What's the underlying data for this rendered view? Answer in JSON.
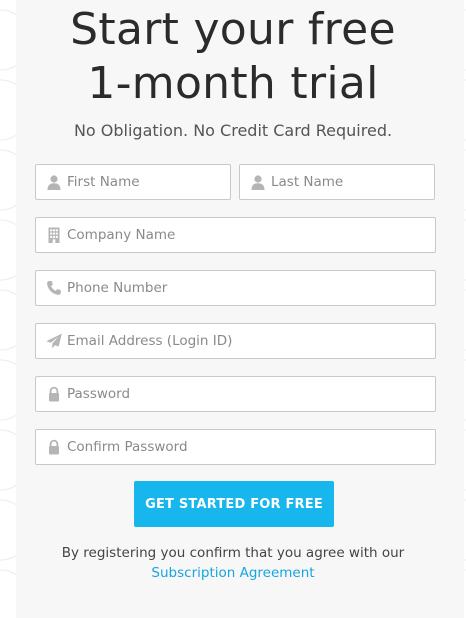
{
  "header": {
    "title_line1": "Start your free",
    "title_line2": "1-month trial",
    "subtitle": "No Obligation. No Credit Card Required."
  },
  "form": {
    "first_name": {
      "placeholder": "First Name",
      "value": "",
      "icon": "person-icon"
    },
    "last_name": {
      "placeholder": "Last Name",
      "value": "",
      "icon": "person-icon"
    },
    "company": {
      "placeholder": "Company Name",
      "value": "",
      "icon": "building-icon"
    },
    "phone": {
      "placeholder": "Phone Number",
      "value": "",
      "icon": "phone-icon"
    },
    "email": {
      "placeholder": "Email Address (Login ID)",
      "value": "",
      "icon": "paper-plane-icon"
    },
    "password": {
      "placeholder": "Password",
      "value": "",
      "icon": "lock-icon"
    },
    "confirm_password": {
      "placeholder": "Confirm Password",
      "value": "",
      "icon": "lock-icon"
    },
    "submit_label": "GET STARTED FOR FREE"
  },
  "legal": {
    "text": "By registering you confirm that you agree with our",
    "link_label": "Subscription Agreement"
  },
  "colors": {
    "accent": "#17b6ec",
    "link": "#17a6dc",
    "title": "#2b2b2b",
    "card_bg": "#f7f7f7",
    "field_border": "#c9c9c9"
  }
}
